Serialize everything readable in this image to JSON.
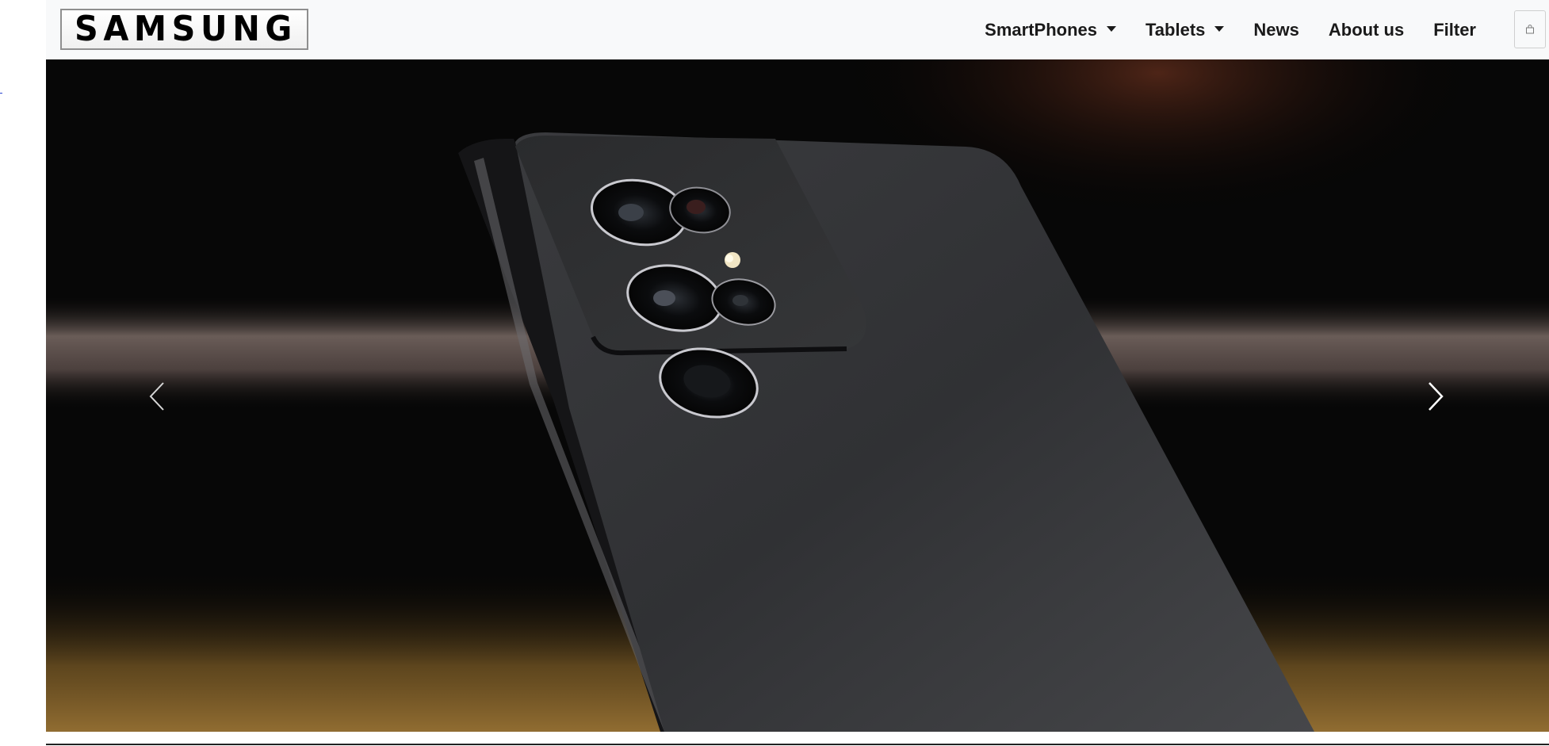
{
  "brand": {
    "logo_text": "SAMSUNG"
  },
  "nav": {
    "items": [
      {
        "label": "SmartPhones",
        "dropdown": true
      },
      {
        "label": "Tablets",
        "dropdown": true
      },
      {
        "label": "News",
        "dropdown": false
      },
      {
        "label": "About us",
        "dropdown": false
      },
      {
        "label": "Filter",
        "dropdown": false
      }
    ],
    "cart_icon": "shopping-bag-icon"
  },
  "hero": {
    "image_subject": "phone-rear-camera-image",
    "prev_icon": "chevron-left-icon",
    "next_icon": "chevron-right-icon"
  },
  "colors": {
    "navbar_bg": "#f8f9fa",
    "nav_text": "#1a1a1a",
    "carousel_bg": "#080808"
  }
}
